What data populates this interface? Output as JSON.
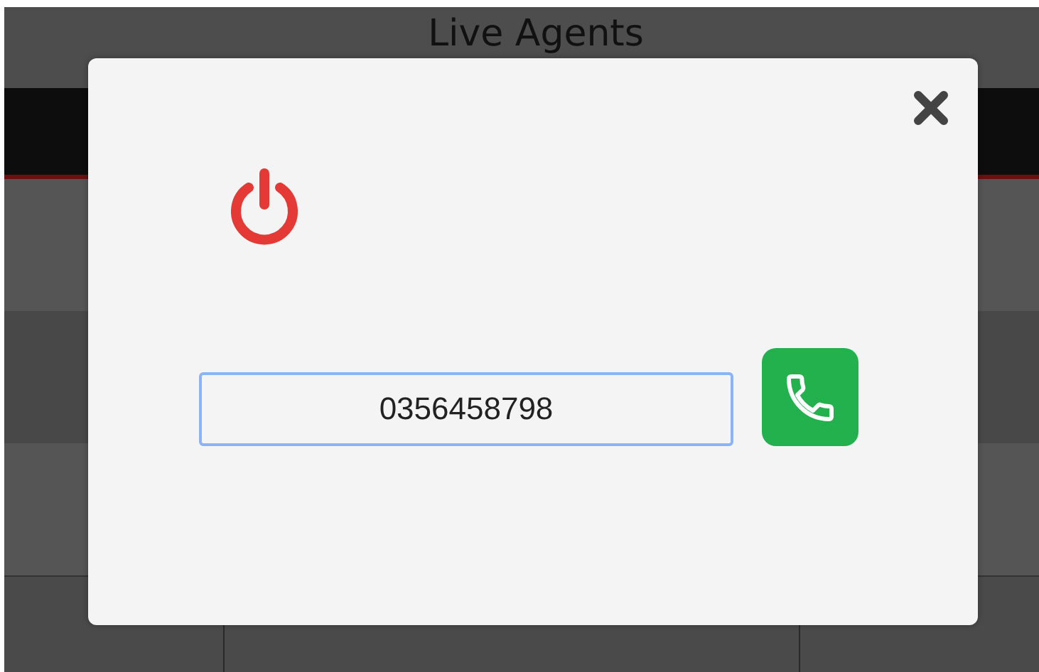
{
  "page": {
    "title": "Live Agents"
  },
  "dialog": {
    "phone_field": {
      "value": "0356458798",
      "focused": true
    }
  }
}
